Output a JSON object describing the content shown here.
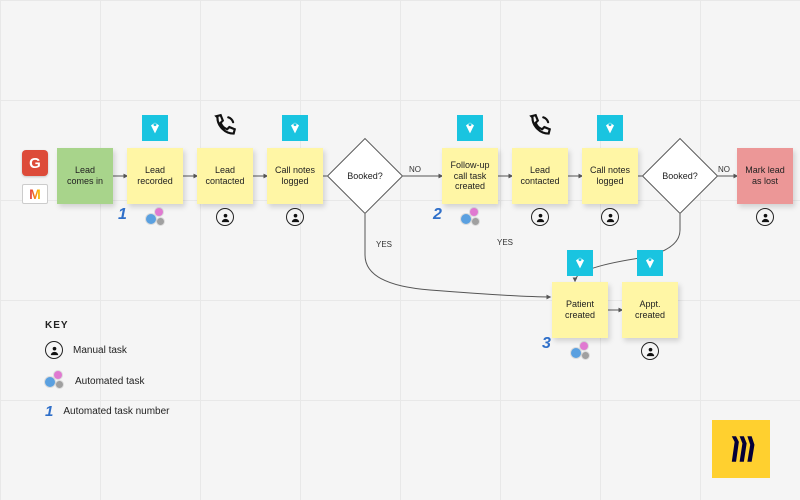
{
  "nodes": {
    "lead_in": {
      "label": "Lead comes in"
    },
    "lead_recorded": {
      "label": "Lead recorded"
    },
    "lead_contacted1": {
      "label": "Lead contacted"
    },
    "notes1": {
      "label": "Call notes logged"
    },
    "followup": {
      "label": "Follow-up call task created"
    },
    "lead_contacted2": {
      "label": "Lead contacted"
    },
    "notes2": {
      "label": "Call notes logged"
    },
    "patient": {
      "label": "Patient created"
    },
    "appt": {
      "label": "Appt. created"
    },
    "mark_lost": {
      "label": "Mark lead as lost"
    }
  },
  "decisions": {
    "booked1": {
      "label": "Booked?"
    },
    "booked2": {
      "label": "Booked?"
    }
  },
  "edge_labels": {
    "no1": "NO",
    "no2": "NO",
    "yes1": "YES",
    "yes2": "YES"
  },
  "numbers": {
    "n1": "1",
    "n2": "2",
    "n3": "3"
  },
  "key": {
    "title": "KEY",
    "manual": "Manual task",
    "automated": "Automated task",
    "number": "Automated task number"
  },
  "icons": {
    "v": "vendor-check-icon",
    "phone": "phone-icon",
    "person": "person-icon",
    "gears": "gears-icon",
    "g_app": "g-app-icon",
    "m_app": "gmail-icon",
    "miro": "miro-logo-icon"
  }
}
